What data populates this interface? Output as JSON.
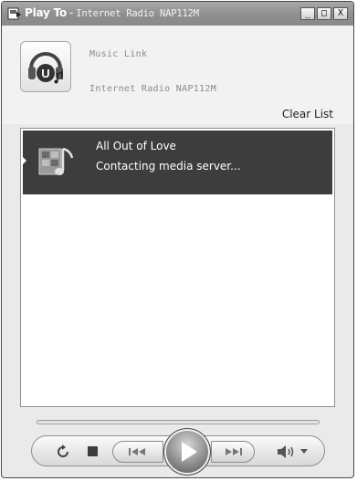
{
  "window": {
    "title": "Play To",
    "title_separator": "-",
    "device_name": "Internet Radio NAP112M",
    "controls": {
      "minimize": "_",
      "maximize": "□",
      "close": "X"
    }
  },
  "header": {
    "device_type": "Music Link",
    "device_name": "Internet Radio NAP112M",
    "clear_list_label": "Clear List",
    "device_icon": "headphones-u-icon"
  },
  "playlist": {
    "items": [
      {
        "title": "All Out of Love",
        "status": "Contacting media server...",
        "icon": "music-file-icon",
        "selected": true
      }
    ]
  },
  "playback": {
    "progress": 0,
    "buttons": [
      "repeat-icon",
      "stop-icon",
      "previous-icon",
      "play-icon",
      "next-icon",
      "volume-icon"
    ]
  }
}
